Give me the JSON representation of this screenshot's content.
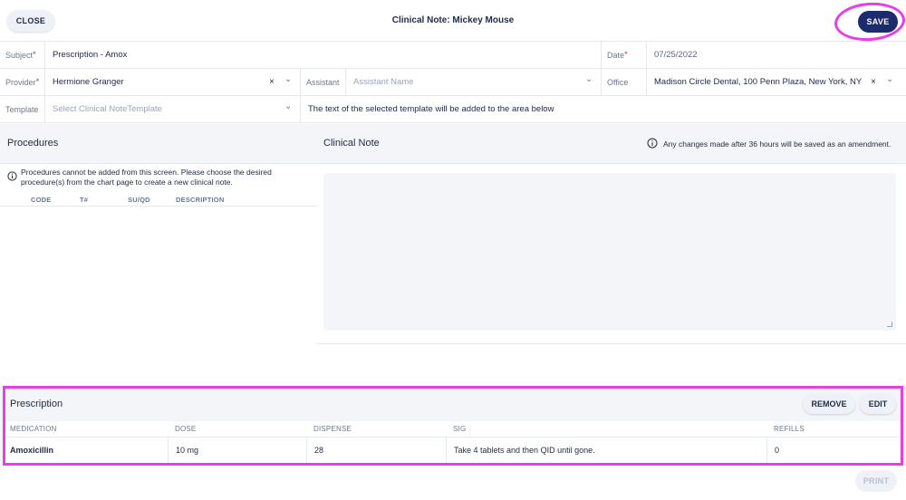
{
  "header": {
    "close_label": "CLOSE",
    "title": "Clinical Note: Mickey Mouse",
    "save_label": "SAVE"
  },
  "form": {
    "subject_label": "Subject",
    "subject_value": "Prescription - Amox",
    "date_label": "Date",
    "date_value": "07/25/2022",
    "provider_label": "Provider",
    "provider_value": "Hermione Granger",
    "assistant_label": "Assistant",
    "assistant_placeholder": "Assistant Name",
    "office_label": "Office",
    "office_value": "Madison Circle Dental, 100 Penn Plaza, New York, NY",
    "template_label": "Template",
    "template_placeholder": "Select Clinical NoteTemplate",
    "template_hint": "The text of the selected template will be added to the area below",
    "required_mark": "*"
  },
  "procedures": {
    "title": "Procedures",
    "info": "Procedures cannot be added from this screen. Please choose the desired procedure(s) from the chart page to create a new clinical note.",
    "columns": [
      "CODE",
      "T#",
      "SU/QD",
      "DESCRIPTION"
    ]
  },
  "clinical_note": {
    "title": "Clinical Note",
    "amend_notice": "Any changes made after 36 hours will be saved as an amendment.",
    "text": ""
  },
  "prescription": {
    "title": "Prescription",
    "remove_label": "REMOVE",
    "edit_label": "EDIT",
    "columns": [
      "MEDICATION",
      "DOSE",
      "DISPENSE",
      "SIG",
      "REFILLS"
    ],
    "rows": [
      {
        "medication": "Amoxicillin",
        "dose": "10 mg",
        "dispense": "28",
        "sig": "Take 4 tablets and then QID until gone.",
        "refills": "0"
      }
    ]
  },
  "footer": {
    "print_label": "PRINT"
  },
  "icons": {
    "clear": "×",
    "chevron": "⌄",
    "info": "i"
  },
  "colors": {
    "accent": "#1b2b6b",
    "highlight": "#e83ee6",
    "required": "#d2343c"
  }
}
